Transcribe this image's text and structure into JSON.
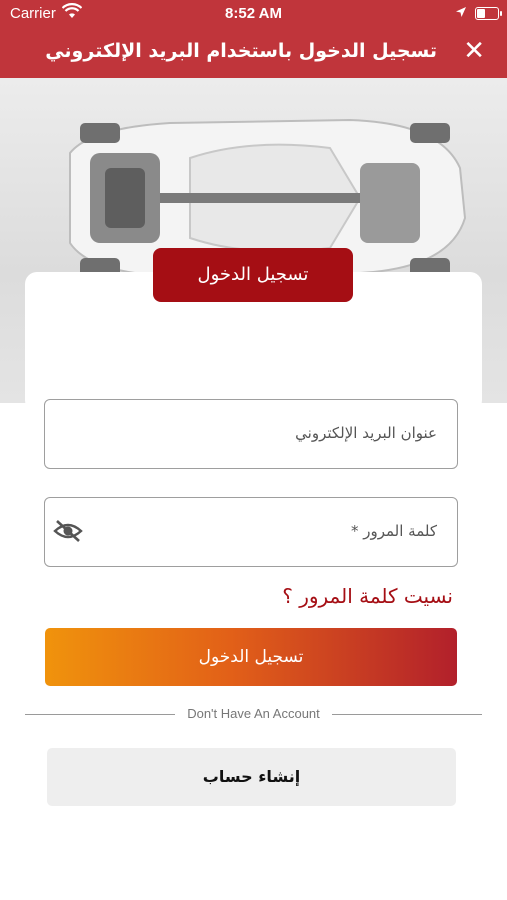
{
  "status_bar": {
    "carrier": "Carrier",
    "time": "8:52 AM",
    "icons": [
      "wifi-icon",
      "location-arrow-icon",
      "battery-icon"
    ]
  },
  "nav": {
    "title": "تسجيل الدخول باستخدام البريد الإلكتروني",
    "close_icon": "close-icon",
    "close_glyph": "✕"
  },
  "login_tab": {
    "label": "تسجيل الدخول"
  },
  "form": {
    "email_placeholder": "عنوان البريد الإلكتروني",
    "password_placeholder": "كلمة المرور *",
    "password_visibility_icon": "eye-slash-icon",
    "forgot_password": "نسيت كلمة المرور ؟",
    "submit_label": "تسجيل الدخول"
  },
  "divider_text": "Don't Have An Account",
  "create_account_label": "إنشاء حساب",
  "colors": {
    "primary_red": "#c0353b",
    "dark_red": "#a50e14",
    "gradient_start": "#f0930c",
    "gradient_end": "#b2202b"
  }
}
